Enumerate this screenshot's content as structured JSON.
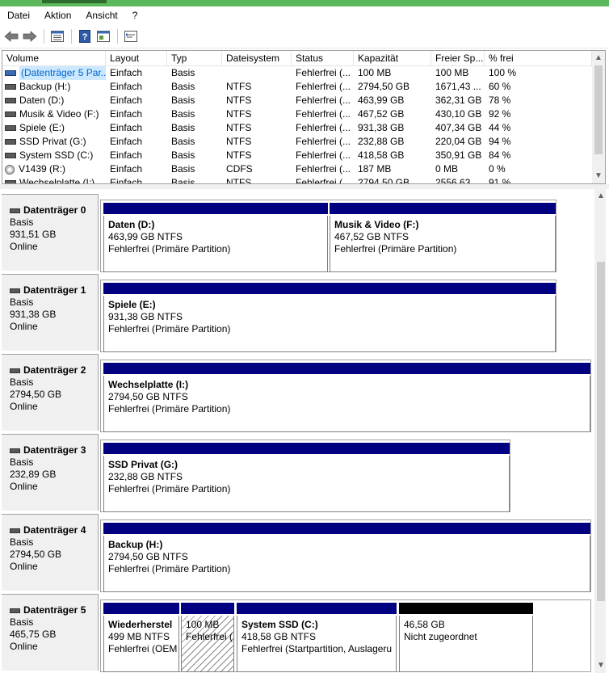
{
  "menu": {
    "items": [
      "Datei",
      "Aktion",
      "Ansicht",
      "?"
    ]
  },
  "toolbar": {
    "buttons": [
      "back-icon",
      "forward-icon",
      "list-view-icon",
      "help-icon",
      "properties-icon",
      "settings-icon"
    ]
  },
  "volumes": {
    "columns": [
      "Volume",
      "Layout",
      "Typ",
      "Dateisystem",
      "Status",
      "Kapazität",
      "Freier Sp...",
      "% frei"
    ],
    "rows": [
      [
        "(Datenträger 5 Par...",
        "Einfach",
        "Basis",
        "",
        "Fehlerfrei (...",
        "100 MB",
        "100 MB",
        "100 %"
      ],
      [
        "Backup (H:)",
        "Einfach",
        "Basis",
        "NTFS",
        "Fehlerfrei (...",
        "2794,50 GB",
        "1671,43 ...",
        "60 %"
      ],
      [
        "Daten (D:)",
        "Einfach",
        "Basis",
        "NTFS",
        "Fehlerfrei (...",
        "463,99 GB",
        "362,31 GB",
        "78 %"
      ],
      [
        "Musik & Video (F:)",
        "Einfach",
        "Basis",
        "NTFS",
        "Fehlerfrei (...",
        "467,52 GB",
        "430,10 GB",
        "92 %"
      ],
      [
        "Spiele (E:)",
        "Einfach",
        "Basis",
        "NTFS",
        "Fehlerfrei (...",
        "931,38 GB",
        "407,34 GB",
        "44 %"
      ],
      [
        "SSD Privat (G:)",
        "Einfach",
        "Basis",
        "NTFS",
        "Fehlerfrei (...",
        "232,88 GB",
        "220,04 GB",
        "94 %"
      ],
      [
        "System SSD (C:)",
        "Einfach",
        "Basis",
        "NTFS",
        "Fehlerfrei (...",
        "418,58 GB",
        "350,91 GB",
        "84 %"
      ],
      [
        "V1439 (R:)",
        "Einfach",
        "Basis",
        "CDFS",
        "Fehlerfrei (...",
        "187 MB",
        "0 MB",
        "0 %"
      ],
      [
        "Wechselplatte (I:)",
        "Einfach",
        "Basis",
        "NTFS",
        "Fehlerfrei (...",
        "2794,50 GB",
        "2556,63 ...",
        "91 %"
      ]
    ]
  },
  "disks": [
    {
      "name": "Datenträger 0",
      "type": "Basis",
      "size": "931,51 GB",
      "state": "Online",
      "partitions": [
        {
          "name": "Daten  (D:)",
          "size": "463,99 GB NTFS",
          "status": "Fehlerfrei (Primäre Partition)"
        },
        {
          "name": "Musik & Video  (F:)",
          "size": "467,52 GB NTFS",
          "status": "Fehlerfrei (Primäre Partition)"
        }
      ]
    },
    {
      "name": "Datenträger 1",
      "type": "Basis",
      "size": "931,38 GB",
      "state": "Online",
      "partitions": [
        {
          "name": "Spiele  (E:)",
          "size": "931,38 GB NTFS",
          "status": "Fehlerfrei (Primäre Partition)"
        }
      ]
    },
    {
      "name": "Datenträger 2",
      "type": "Basis",
      "size": "2794,50 GB",
      "state": "Online",
      "partitions": [
        {
          "name": "Wechselplatte  (I:)",
          "size": "2794,50 GB NTFS",
          "status": "Fehlerfrei (Primäre Partition)"
        }
      ]
    },
    {
      "name": "Datenträger 3",
      "type": "Basis",
      "size": "232,89 GB",
      "state": "Online",
      "partitions": [
        {
          "name": "SSD Privat  (G:)",
          "size": "232,88 GB NTFS",
          "status": "Fehlerfrei (Primäre Partition)"
        }
      ]
    },
    {
      "name": "Datenträger 4",
      "type": "Basis",
      "size": "2794,50 GB",
      "state": "Online",
      "partitions": [
        {
          "name": "Backup  (H:)",
          "size": "2794,50 GB NTFS",
          "status": "Fehlerfrei (Primäre Partition)"
        }
      ]
    },
    {
      "name": "Datenträger 5",
      "type": "Basis",
      "size": "465,75 GB",
      "state": "Online",
      "partitions": [
        {
          "name": "Wiederherstel",
          "size": "499 MB NTFS",
          "status": "Fehlerfrei (OEM"
        },
        {
          "name": "",
          "size": "100 MB",
          "status": "Fehlerfrei ("
        },
        {
          "name": "System SSD  (C:)",
          "size": "418,58 GB NTFS",
          "status": "Fehlerfrei (Startpartition, Auslageru"
        },
        {
          "name": "",
          "size": "46,58 GB",
          "status": "Nicht zugeordnet"
        }
      ]
    }
  ],
  "colors": {
    "primary_partition": "#000080",
    "unallocated": "#000000",
    "selection": "#cce8ff",
    "titlebar": "#5cb85c"
  }
}
